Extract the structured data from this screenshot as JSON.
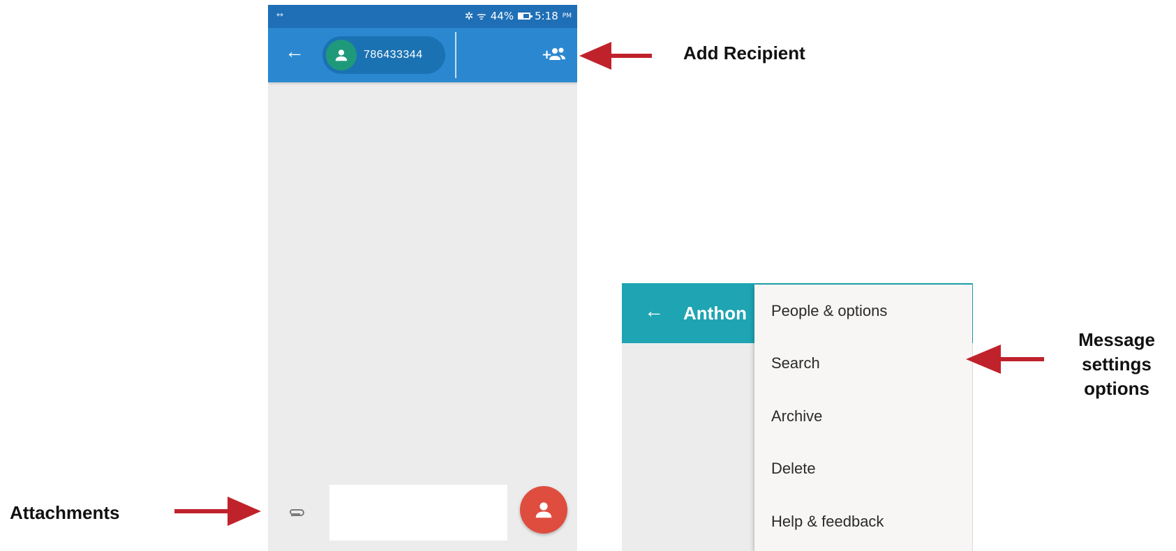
{
  "status_bar": {
    "icons": "✲ ᯤ",
    "battery": "44%",
    "time": "5:18",
    "time_suffix": "PM"
  },
  "conversation": {
    "recipient_number": "786433344",
    "compose_placeholder": ""
  },
  "overflow_screen": {
    "title": "Anthon",
    "menu_items": [
      "People & options",
      "Search",
      "Archive",
      "Delete",
      "Help & feedback"
    ]
  },
  "callouts": {
    "add_recipient": "Add Recipient",
    "attachments": "Attachments",
    "message_settings": [
      "Message",
      "settings",
      "options"
    ]
  },
  "colors": {
    "status_bar": "#1f6fb6",
    "app_bar": "#2b88d0",
    "app_bar_teal": "#1ea4b2",
    "fab_red": "#df4d3f",
    "avatar_green": "#1e9a7a",
    "arrow_red": "#c0222b"
  },
  "icons": [
    "back-arrow-icon",
    "person-icon",
    "add-people-icon",
    "paperclip-icon",
    "battery-icon",
    "wifi-icon"
  ]
}
